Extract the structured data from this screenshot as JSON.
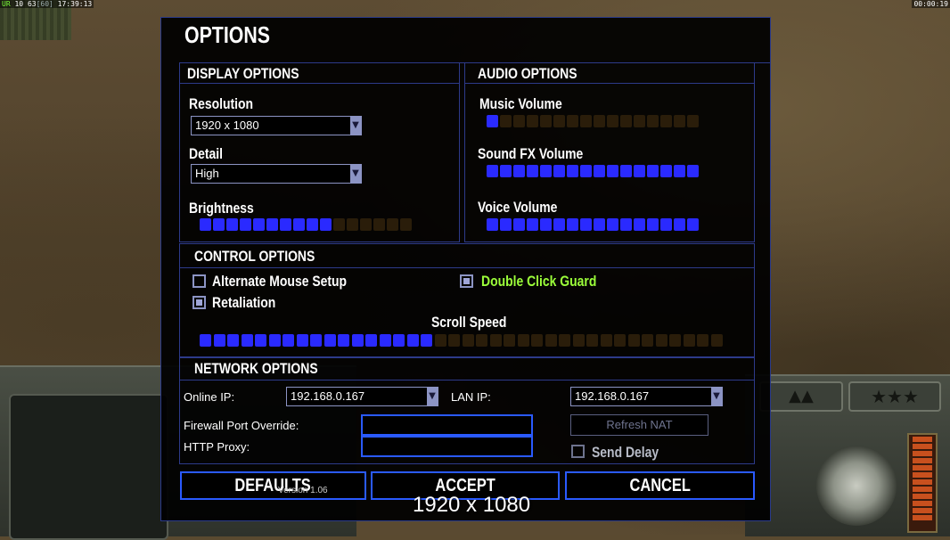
{
  "hud": {
    "top_left_prefix": "UR",
    "top_left_fps": "10",
    "top_left_num": "63",
    "top_left_bracket": "[60]",
    "top_left_time": "17:39:13",
    "top_right_time": "00:00:19"
  },
  "dialog": {
    "title": "OPTIONS",
    "version": "Version 1.06"
  },
  "display": {
    "header": "DISPLAY OPTIONS",
    "resolution_label": "Resolution",
    "resolution_value": "1920 x 1080",
    "detail_label": "Detail",
    "detail_value": "High",
    "brightness_label": "Brightness",
    "brightness": {
      "filled": 10,
      "total": 16
    }
  },
  "audio": {
    "header": "AUDIO OPTIONS",
    "music_label": "Music Volume",
    "music": {
      "filled": 1,
      "total": 16
    },
    "sfx_label": "Sound FX Volume",
    "sfx": {
      "filled": 16,
      "total": 16
    },
    "voice_label": "Voice Volume",
    "voice": {
      "filled": 16,
      "total": 16
    }
  },
  "control": {
    "header": "CONTROL OPTIONS",
    "alt_mouse_label": "Alternate Mouse Setup",
    "alt_mouse_checked": false,
    "double_click_label": "Double Click Guard",
    "double_click_checked": true,
    "retaliation_label": "Retaliation",
    "retaliation_checked": true,
    "scroll_label": "Scroll Speed",
    "scroll": {
      "filled": 17,
      "total": 38
    }
  },
  "network": {
    "header": "NETWORK OPTIONS",
    "online_ip_label": "Online IP:",
    "online_ip_value": "192.168.0.167",
    "lan_ip_label": "LAN IP:",
    "lan_ip_value": "192.168.0.167",
    "firewall_label": "Firewall Port Override:",
    "firewall_value": "",
    "proxy_label": "HTTP Proxy:",
    "proxy_value": "",
    "refresh_label": "Refresh NAT",
    "send_delay_label": "Send Delay",
    "send_delay_checked": false
  },
  "buttons": {
    "defaults": "DEFAULTS",
    "accept": "ACCEPT",
    "cancel": "CANCEL"
  },
  "overlay": {
    "resolution_text": "1920 x 1080"
  },
  "colors": {
    "accent_blue": "#2a2aff",
    "border_blue": "#2d3a8a",
    "highlight_green": "#9cff3a"
  }
}
